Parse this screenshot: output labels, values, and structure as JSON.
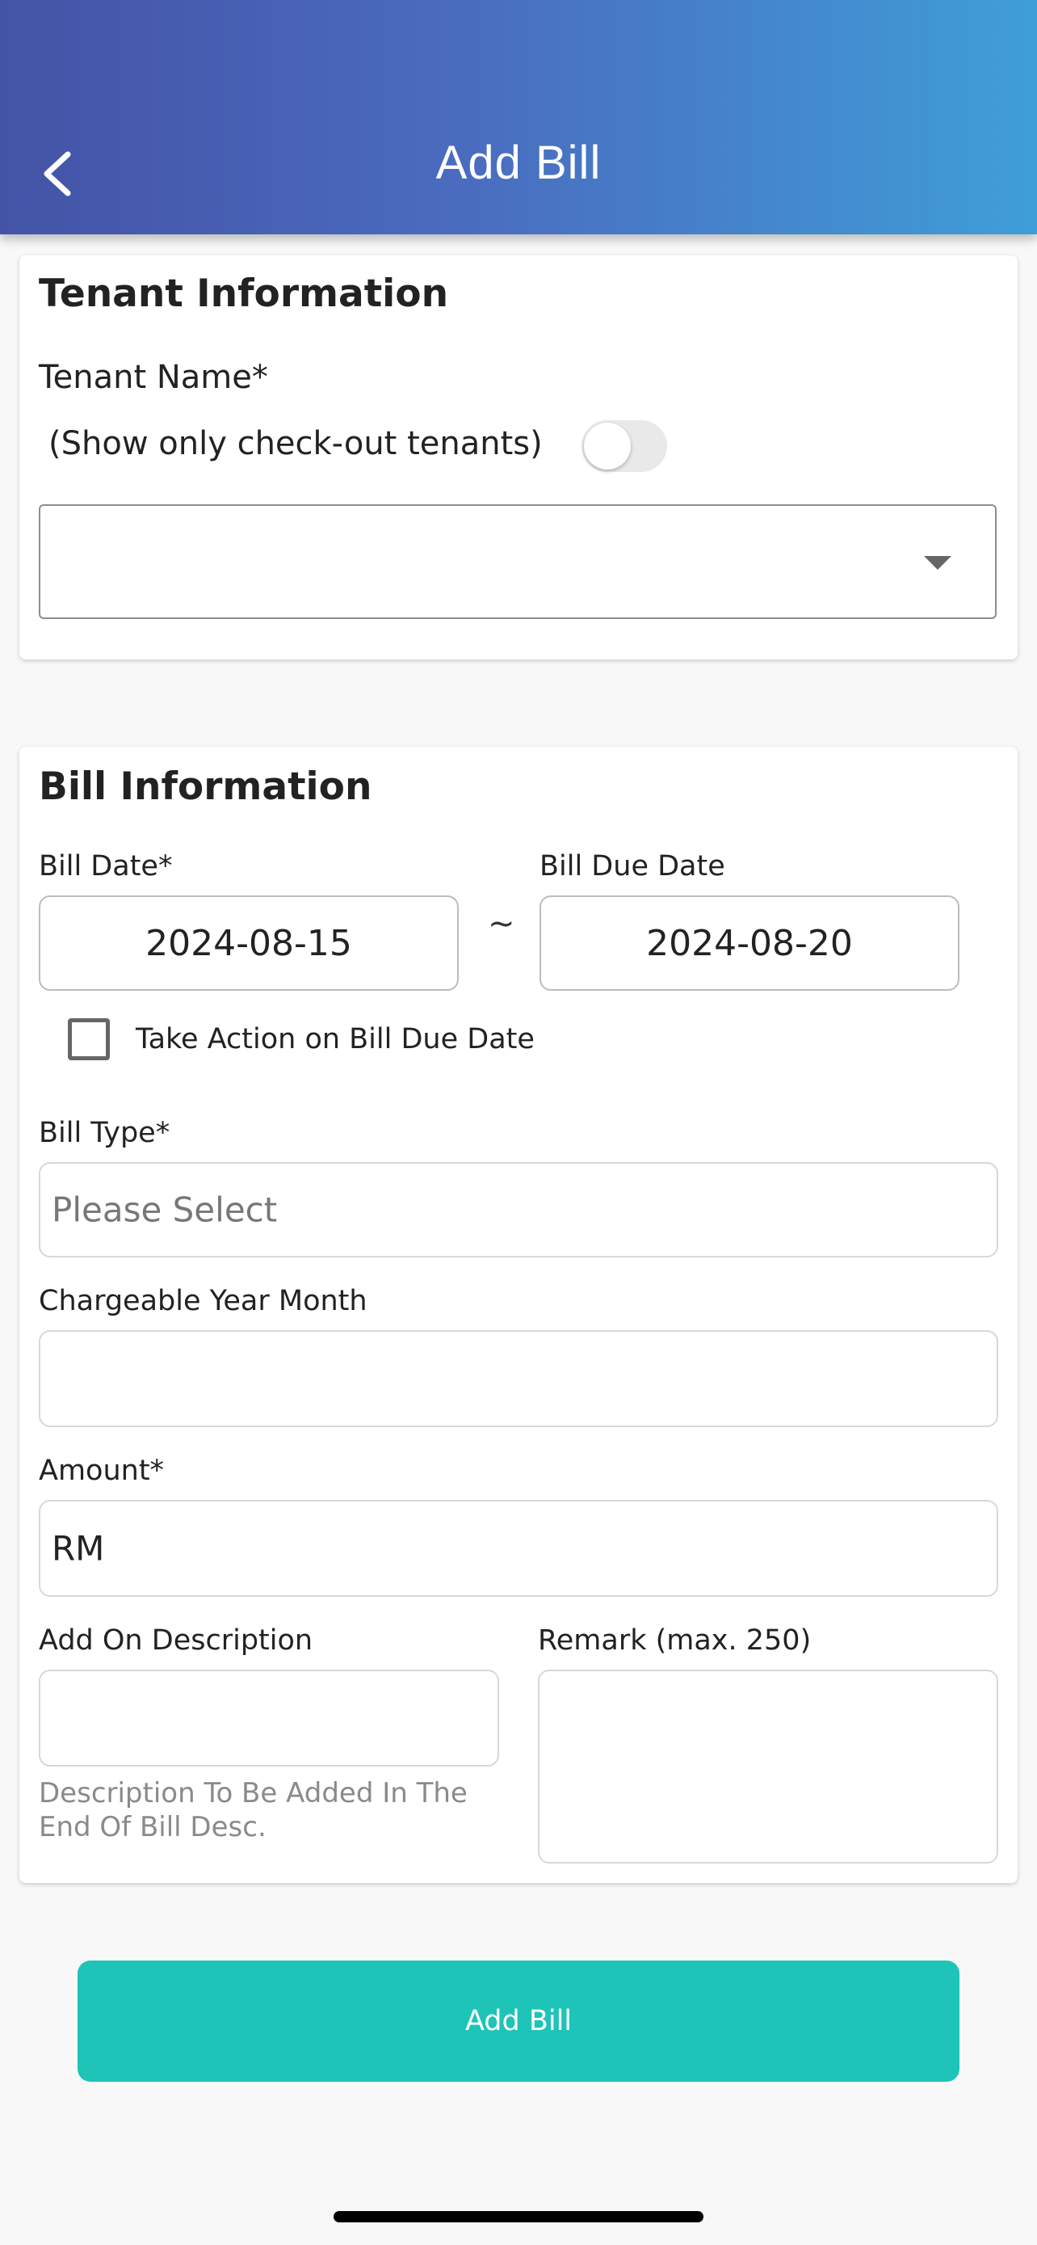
{
  "header": {
    "title": "Add Bill",
    "back_icon": "chevron-left-icon"
  },
  "tenant_section": {
    "title": "Tenant Information",
    "name_label": "Tenant Name*",
    "checkout_toggle_label": "(Show only check-out tenants)",
    "checkout_toggle_on": false,
    "select_value": "",
    "select_icon": "caret-down-icon"
  },
  "bill_section": {
    "title": "Bill Information",
    "bill_date_label": "Bill Date*",
    "bill_date_value": "2024-08-15",
    "date_separator": "~",
    "due_date_label": "Bill Due Date",
    "due_date_value": "2024-08-20",
    "take_action_label": "Take Action on Bill Due Date",
    "take_action_checked": false,
    "bill_type_label": "Bill Type*",
    "bill_type_placeholder": "Please Select",
    "chargeable_label": "Chargeable Year Month",
    "chargeable_value": "",
    "amount_label": "Amount*",
    "amount_prefix": "RM",
    "amount_value": "",
    "addon_label": "Add On Description",
    "addon_value": "",
    "addon_helper": "Description To Be Added In The End Of Bill Desc.",
    "remark_label": "Remark (max. 250)",
    "remark_value": ""
  },
  "actions": {
    "submit_label": "Add Bill"
  },
  "colors": {
    "header_gradient_start": "#4453a6",
    "header_gradient_end": "#3f9ed8",
    "submit_button": "#1dc4b7",
    "page_background": "#f8f8f8"
  }
}
